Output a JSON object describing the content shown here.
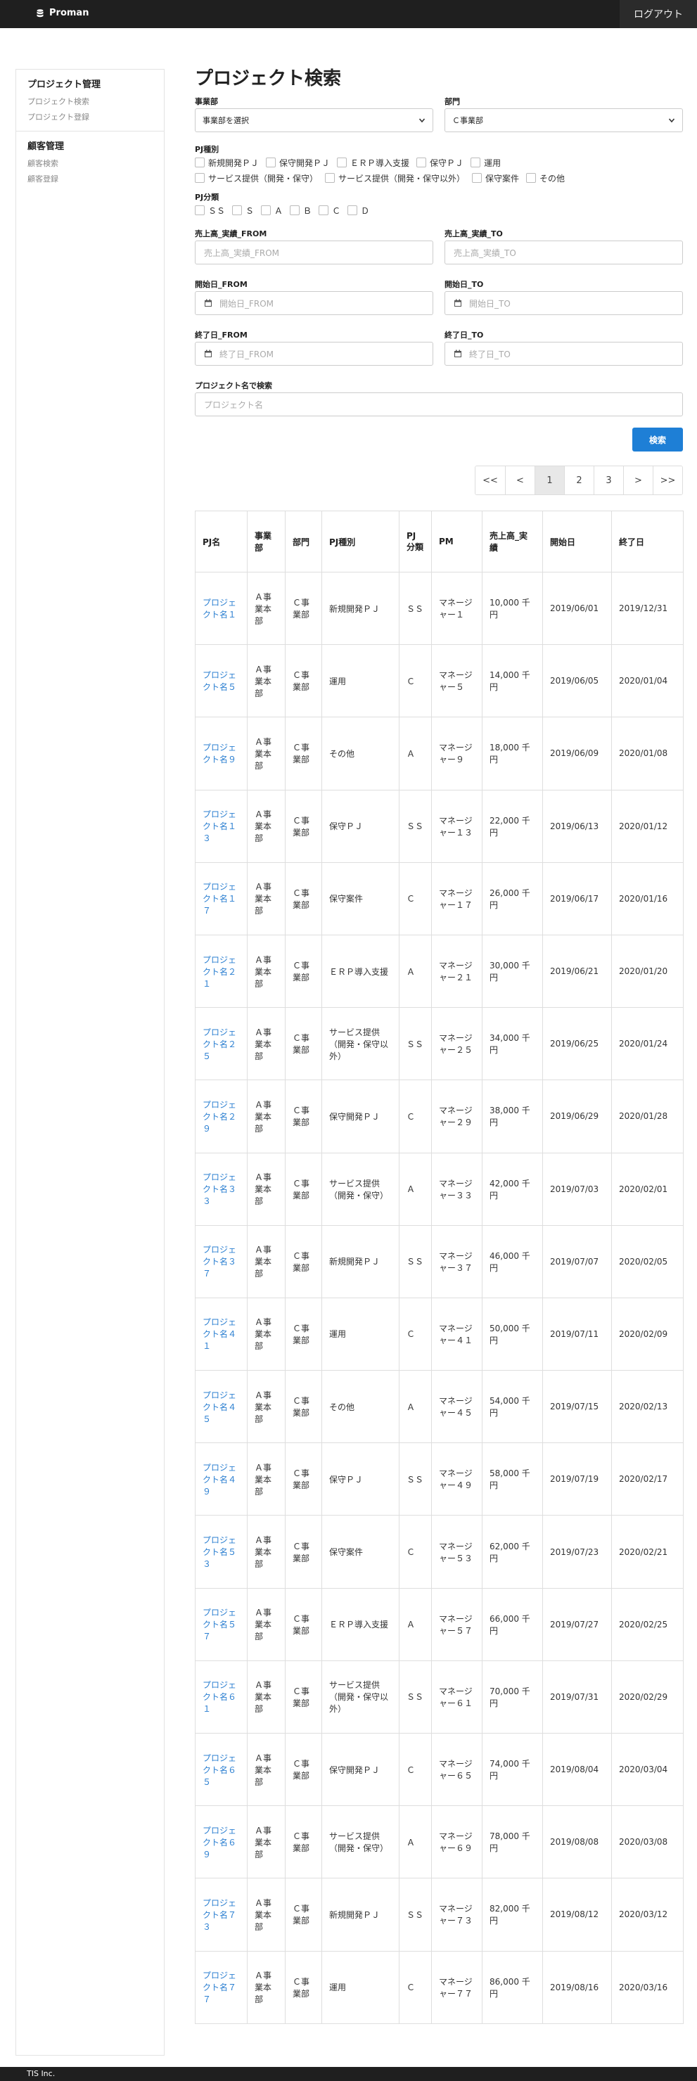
{
  "navbar": {
    "brand": "Proman",
    "logout": "ログアウト"
  },
  "sidebar": {
    "groups": [
      {
        "heading": "プロジェクト管理",
        "links": [
          "プロジェクト検索",
          "プロジェクト登録"
        ]
      },
      {
        "heading": "顧客管理",
        "links": [
          "顧客検索",
          "顧客登録"
        ]
      }
    ]
  },
  "page": {
    "title": "プロジェクト検索"
  },
  "form": {
    "division_label": "事業部",
    "division_value": "事業部を選択",
    "department_label": "部門",
    "department_value": "Ｃ事業部",
    "pj_type_label": "PJ種別",
    "pj_types": [
      "新規開発ＰＪ",
      "保守開発ＰＪ",
      "ＥＲＰ導入支援",
      "保守ＰＪ",
      "運用",
      "サービス提供（開発・保守）",
      "サービス提供（開発・保守以外）",
      "保守案件",
      "その他"
    ],
    "pj_class_label": "PJ分類",
    "pj_classes": [
      "ＳＳ",
      "Ｓ",
      "Ａ",
      "Ｂ",
      "Ｃ",
      "Ｄ"
    ],
    "sales_from_label": "売上高_実績_FROM",
    "sales_from_placeholder": "売上高_実績_FROM",
    "sales_to_label": "売上高_実績_TO",
    "sales_to_placeholder": "売上高_実績_TO",
    "start_from_label": "開始日_FROM",
    "start_from_placeholder": "開始日_FROM",
    "start_to_label": "開始日_TO",
    "start_to_placeholder": "開始日_TO",
    "end_from_label": "終了日_FROM",
    "end_from_placeholder": "終了日_FROM",
    "end_to_label": "終了日_TO",
    "end_to_placeholder": "終了日_TO",
    "name_label": "プロジェクト名で検索",
    "name_placeholder": "プロジェクト名",
    "search_button": "検索"
  },
  "pagination": {
    "first": "<<",
    "prev": "<",
    "pages": [
      "1",
      "2",
      "3"
    ],
    "current": "1",
    "next": ">",
    "last": ">>"
  },
  "table": {
    "headers": [
      "PJ名",
      "事業部",
      "部門",
      "PJ種別",
      "PJ分類",
      "PM",
      "売上高_実績",
      "開始日",
      "終了日"
    ],
    "rows": [
      [
        "プロジェクト名１",
        "Ａ事業本部",
        "Ｃ事業部",
        "新規開発ＰＪ",
        "ＳＳ",
        "マネージャー１",
        "10,000 千円",
        "2019/06/01",
        "2019/12/31"
      ],
      [
        "プロジェクト名５",
        "Ａ事業本部",
        "Ｃ事業部",
        "運用",
        "Ｃ",
        "マネージャー５",
        "14,000 千円",
        "2019/06/05",
        "2020/01/04"
      ],
      [
        "プロジェクト名９",
        "Ａ事業本部",
        "Ｃ事業部",
        "その他",
        "Ａ",
        "マネージャー９",
        "18,000 千円",
        "2019/06/09",
        "2020/01/08"
      ],
      [
        "プロジェクト名１３",
        "Ａ事業本部",
        "Ｃ事業部",
        "保守ＰＪ",
        "ＳＳ",
        "マネージャー１３",
        "22,000 千円",
        "2019/06/13",
        "2020/01/12"
      ],
      [
        "プロジェクト名１７",
        "Ａ事業本部",
        "Ｃ事業部",
        "保守案件",
        "Ｃ",
        "マネージャー１７",
        "26,000 千円",
        "2019/06/17",
        "2020/01/16"
      ],
      [
        "プロジェクト名２１",
        "Ａ事業本部",
        "Ｃ事業部",
        "ＥＲＰ導入支援",
        "Ａ",
        "マネージャー２１",
        "30,000 千円",
        "2019/06/21",
        "2020/01/20"
      ],
      [
        "プロジェクト名２５",
        "Ａ事業本部",
        "Ｃ事業部",
        "サービス提供（開発・保守以外）",
        "ＳＳ",
        "マネージャー２５",
        "34,000 千円",
        "2019/06/25",
        "2020/01/24"
      ],
      [
        "プロジェクト名２９",
        "Ａ事業本部",
        "Ｃ事業部",
        "保守開発ＰＪ",
        "Ｃ",
        "マネージャー２９",
        "38,000 千円",
        "2019/06/29",
        "2020/01/28"
      ],
      [
        "プロジェクト名３３",
        "Ａ事業本部",
        "Ｃ事業部",
        "サービス提供（開発・保守）",
        "Ａ",
        "マネージャー３３",
        "42,000 千円",
        "2019/07/03",
        "2020/02/01"
      ],
      [
        "プロジェクト名３７",
        "Ａ事業本部",
        "Ｃ事業部",
        "新規開発ＰＪ",
        "ＳＳ",
        "マネージャー３７",
        "46,000 千円",
        "2019/07/07",
        "2020/02/05"
      ],
      [
        "プロジェクト名４１",
        "Ａ事業本部",
        "Ｃ事業部",
        "運用",
        "Ｃ",
        "マネージャー４１",
        "50,000 千円",
        "2019/07/11",
        "2020/02/09"
      ],
      [
        "プロジェクト名４５",
        "Ａ事業本部",
        "Ｃ事業部",
        "その他",
        "Ａ",
        "マネージャー４５",
        "54,000 千円",
        "2019/07/15",
        "2020/02/13"
      ],
      [
        "プロジェクト名４９",
        "Ａ事業本部",
        "Ｃ事業部",
        "保守ＰＪ",
        "ＳＳ",
        "マネージャー４９",
        "58,000 千円",
        "2019/07/19",
        "2020/02/17"
      ],
      [
        "プロジェクト名５３",
        "Ａ事業本部",
        "Ｃ事業部",
        "保守案件",
        "Ｃ",
        "マネージャー５３",
        "62,000 千円",
        "2019/07/23",
        "2020/02/21"
      ],
      [
        "プロジェクト名５７",
        "Ａ事業本部",
        "Ｃ事業部",
        "ＥＲＰ導入支援",
        "Ａ",
        "マネージャー５７",
        "66,000 千円",
        "2019/07/27",
        "2020/02/25"
      ],
      [
        "プロジェクト名６１",
        "Ａ事業本部",
        "Ｃ事業部",
        "サービス提供（開発・保守以外）",
        "ＳＳ",
        "マネージャー６１",
        "70,000 千円",
        "2019/07/31",
        "2020/02/29"
      ],
      [
        "プロジェクト名６５",
        "Ａ事業本部",
        "Ｃ事業部",
        "保守開発ＰＪ",
        "Ｃ",
        "マネージャー６５",
        "74,000 千円",
        "2019/08/04",
        "2020/03/04"
      ],
      [
        "プロジェクト名６９",
        "Ａ事業本部",
        "Ｃ事業部",
        "サービス提供（開発・保守）",
        "Ａ",
        "マネージャー６９",
        "78,000 千円",
        "2019/08/08",
        "2020/03/08"
      ],
      [
        "プロジェクト名７３",
        "Ａ事業本部",
        "Ｃ事業部",
        "新規開発ＰＪ",
        "ＳＳ",
        "マネージャー７３",
        "82,000 千円",
        "2019/08/12",
        "2020/03/12"
      ],
      [
        "プロジェクト名７７",
        "Ａ事業本部",
        "Ｃ事業部",
        "運用",
        "Ｃ",
        "マネージャー７７",
        "86,000 千円",
        "2019/08/16",
        "2020/03/16"
      ]
    ]
  },
  "footer": {
    "text": "TIS Inc."
  },
  "icons": {
    "brand": "database-icon",
    "calendar": "calendar-icon",
    "select": "chevron-down-icon"
  },
  "colors": {
    "accent": "#1e7fd6",
    "link": "#2b7fd1",
    "navbar": "#1f1f1f"
  }
}
